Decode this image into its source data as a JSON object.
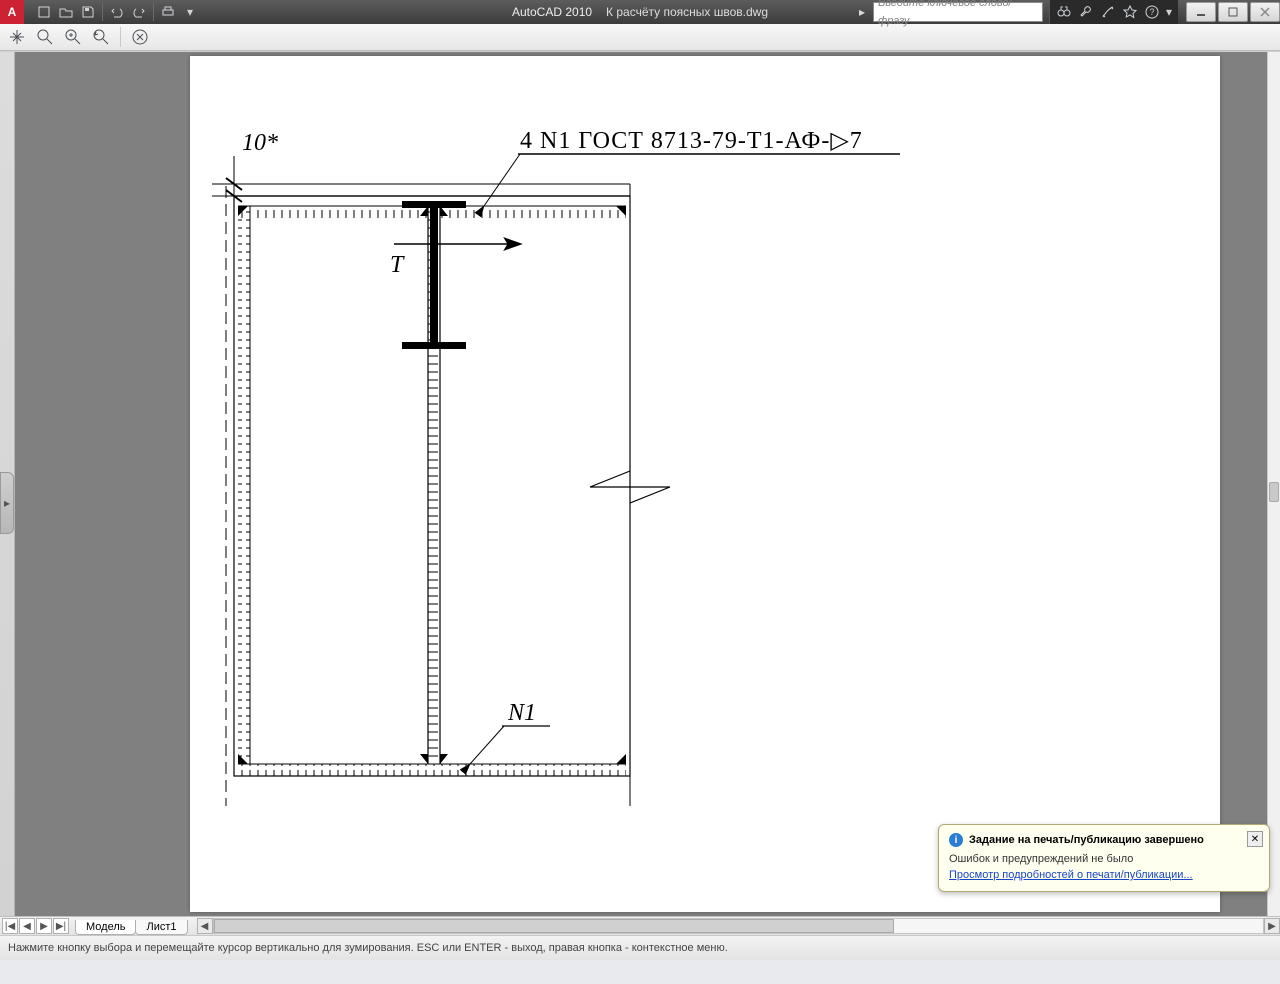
{
  "titlebar": {
    "app_name": "AutoCAD 2010",
    "document_name": "К расчёту поясных швов.dwg",
    "search_placeholder": "Введите ключевое слово/фразу"
  },
  "layout_tabs": {
    "nav": {
      "first": "|◀",
      "prev": "◀",
      "next": "▶",
      "last": "▶|"
    },
    "active": "Модель",
    "items": [
      "Модель",
      "Лист1"
    ]
  },
  "statusbar": {
    "text": "Нажмите кнопку выбора и перемещайте курсор вертикально для зумирования. ESC или ENTER - выход, правая кнопка - контекстное меню."
  },
  "balloon": {
    "title": "Задание на печать/публикацию завершено",
    "message": "Ошибок и предупреждений не было",
    "link": "Просмотр подробностей о печати/публикации..."
  },
  "drawing": {
    "dim_label": "10*",
    "main_note": "4 N1 ГОСТ 8713-79-Т1-АФ-▷7",
    "T_label": "T",
    "N1_label": "N1"
  }
}
